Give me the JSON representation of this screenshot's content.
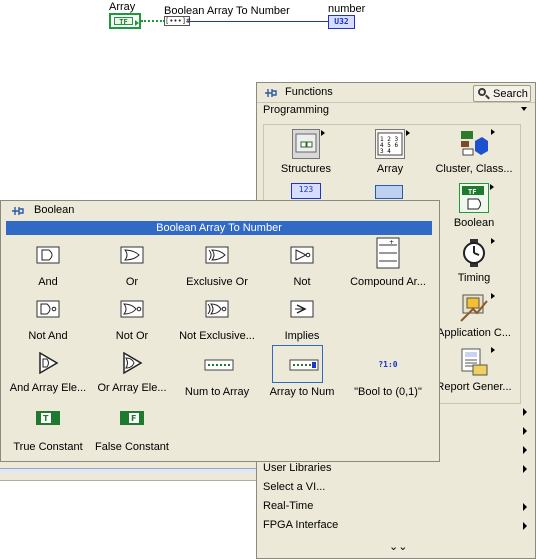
{
  "diagram": {
    "array_label": "Array",
    "array_glyph": "TF",
    "function_label": "Boolean Array To Number",
    "function_glyph": "[•••]#",
    "number_label": "number",
    "number_glyph": "U32"
  },
  "functions_palette": {
    "title": "Functions",
    "search_label": "Search",
    "category": "Programming",
    "items": [
      {
        "label": "Structures",
        "icon": "structures-icon"
      },
      {
        "label": "Array",
        "icon": "array-icon",
        "glyph": "1 2 3 4 5 6 3 4"
      },
      {
        "label": "Cluster, Class...",
        "icon": "cluster-icon"
      },
      {
        "label": "Boolean",
        "icon": "boolean-icon",
        "glyph": "TF"
      },
      {
        "label": "Timing",
        "icon": "timing-icon"
      },
      {
        "label": "Application C...",
        "icon": "application-control-icon"
      },
      {
        "label": "Report Gener...",
        "icon": "report-generation-icon"
      }
    ],
    "partial_glyphs": [
      "123"
    ],
    "rows": [
      {
        "label": "",
        "arrow": true
      },
      {
        "label": "",
        "arrow": true
      },
      {
        "label": "",
        "arrow": true
      },
      {
        "label": "User Libraries",
        "arrow": true
      },
      {
        "label": "Select a VI...",
        "arrow": false
      },
      {
        "label": "Real-Time",
        "arrow": true
      },
      {
        "label": "FPGA Interface",
        "arrow": true
      }
    ],
    "more_glyph": "⌄⌄"
  },
  "boolean_palette": {
    "title": "Boolean",
    "selected": "Boolean Array To Number",
    "items": [
      {
        "label": "And",
        "icon": "and-icon"
      },
      {
        "label": "Or",
        "icon": "or-icon"
      },
      {
        "label": "Exclusive Or",
        "icon": "exclusive-or-icon"
      },
      {
        "label": "Not",
        "icon": "not-icon"
      },
      {
        "label": "Compound Ar...",
        "icon": "compound-arithmetic-icon"
      },
      {
        "label": "Not And",
        "icon": "not-and-icon"
      },
      {
        "label": "Not Or",
        "icon": "not-or-icon"
      },
      {
        "label": "Not Exclusive...",
        "icon": "not-exclusive-or-icon"
      },
      {
        "label": "Implies",
        "icon": "implies-icon"
      },
      {
        "label": "And Array Ele...",
        "icon": "and-array-elements-icon"
      },
      {
        "label": "Or Array Ele...",
        "icon": "or-array-elements-icon"
      },
      {
        "label": "Num to Array",
        "icon": "num-to-array-icon"
      },
      {
        "label": "Array to Num",
        "icon": "array-to-num-icon"
      },
      {
        "label": "\"Bool to (0,1)\"",
        "icon": "bool-to-01-icon",
        "glyph": "?1:0"
      },
      {
        "label": "True Constant",
        "icon": "true-constant-icon"
      },
      {
        "label": "False Constant",
        "icon": "false-constant-icon"
      }
    ]
  },
  "colors": {
    "palette_bg": "#ece9d8",
    "selection": "#316ac5",
    "boolean_wire": "#1f9a3a",
    "numeric_wire": "#1c34c8"
  }
}
